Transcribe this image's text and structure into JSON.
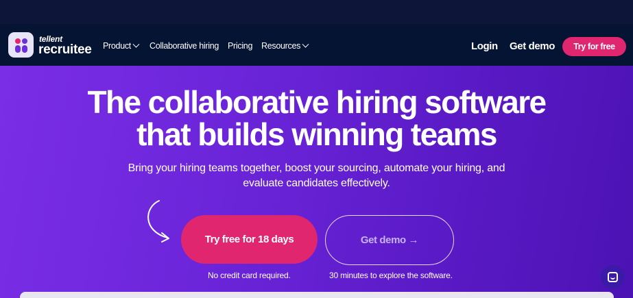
{
  "brand": {
    "small": "tellent",
    "main": "recruitee"
  },
  "nav": {
    "items": [
      {
        "label": "Product",
        "has_dropdown": true
      },
      {
        "label": "Collaborative hiring",
        "has_dropdown": false
      },
      {
        "label": "Pricing",
        "has_dropdown": false
      },
      {
        "label": "Resources",
        "has_dropdown": true
      }
    ],
    "login": "Login",
    "get_demo": "Get demo",
    "try_free": "Try for free"
  },
  "hero": {
    "title_line1": "The collaborative hiring software",
    "title_line2": "that builds winning teams",
    "subtitle_line1": "Bring your hiring teams together, boost your sourcing, automate your hiring, and",
    "subtitle_line2": "evaluate candidates effectively.",
    "cta_primary": "Try free for 18 days",
    "cta_secondary": "Get demo →",
    "note_primary": "No credit card required.",
    "note_secondary": "30 minutes to explore the software."
  },
  "icons": {
    "arrow": "curved-arrow-icon",
    "chevron": "chevron-down-icon",
    "chat": "chat-icon"
  },
  "colors": {
    "nav_bg": "#051433",
    "accent": "#e0266f",
    "hero_purple": "#6a24d8",
    "chat_bg": "#3b1aa8"
  }
}
